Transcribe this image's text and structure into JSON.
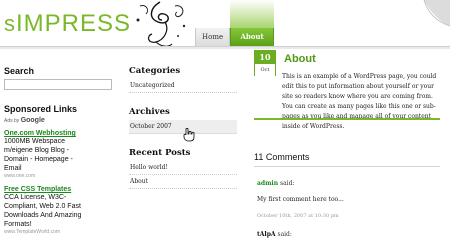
{
  "header": {
    "logo_prefix": "s",
    "logo_main": "IMPRESS",
    "nav": [
      {
        "label": "Home"
      },
      {
        "label": "About"
      }
    ]
  },
  "left_sidebar": {
    "search_heading": "Search",
    "sponsored_heading": "Sponsored Links",
    "ads_by": "Ads by",
    "ads_brand": "Google",
    "ads": [
      {
        "title": "One.com Webhosting",
        "lines": [
          "1000MB Webspace",
          "m/eigene Blog Blog -",
          "Domain - Homepage -",
          "Email"
        ],
        "url": "www.one.com"
      },
      {
        "title": "Free CSS Templates",
        "lines": [
          "CCA License, W3C-",
          "Compliant, Web 2.0 Fast",
          "Downloads And Amazing",
          "Formats!"
        ],
        "url": "www.TemplateWorld.com"
      }
    ]
  },
  "middle": {
    "categories_heading": "Categories",
    "categories": [
      "Uncategorized"
    ],
    "archives_heading": "Archives",
    "archives": [
      "October 2007"
    ],
    "recent_heading": "Recent Posts",
    "recent": [
      "Hello world!",
      "About"
    ]
  },
  "post": {
    "day": "10",
    "month": "Oct",
    "title": "About",
    "body": "This is an example of a WordPress page, you could edit this to put information about yourself or your site so readers know where you are coming from. You can create as many pages like this one or sub-pages as you like and manage all of your content inside of WordPress."
  },
  "comments": {
    "heading": "11 Comments",
    "said": "said:",
    "items": [
      {
        "author": "admin",
        "text": "My first comment here too...",
        "date": "October 10th, 2007 at 10:30 pm"
      },
      {
        "author": "tAlpA",
        "text": "",
        "date": ""
      }
    ]
  }
}
